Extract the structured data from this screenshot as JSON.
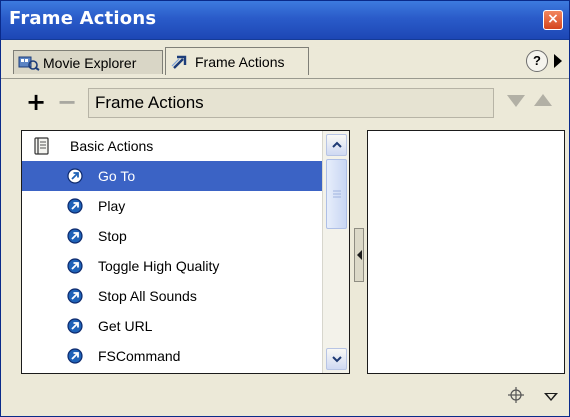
{
  "window": {
    "title": "Frame Actions",
    "close_glyph": "×"
  },
  "tabs": [
    {
      "label": "Movie Explorer",
      "icon": "movie-explorer-icon"
    },
    {
      "label": "Frame Actions",
      "icon": "frame-actions-icon"
    }
  ],
  "panel_controls": {
    "help_glyph": "?"
  },
  "toolbar": {
    "add_glyph": "+",
    "remove_glyph": "−",
    "field_value": "Frame Actions"
  },
  "action_list": {
    "category": "Basic Actions",
    "items": [
      {
        "label": "Go To",
        "selected": true
      },
      {
        "label": "Play",
        "selected": false
      },
      {
        "label": "Stop",
        "selected": false
      },
      {
        "label": "Toggle High Quality",
        "selected": false
      },
      {
        "label": "Stop All Sounds",
        "selected": false
      },
      {
        "label": "Get URL",
        "selected": false
      },
      {
        "label": "FSCommand",
        "selected": false
      }
    ]
  },
  "colors": {
    "titlebar": "#2a5bc9",
    "selection": "#3b63c5",
    "action_icon": "#1f63b8"
  }
}
